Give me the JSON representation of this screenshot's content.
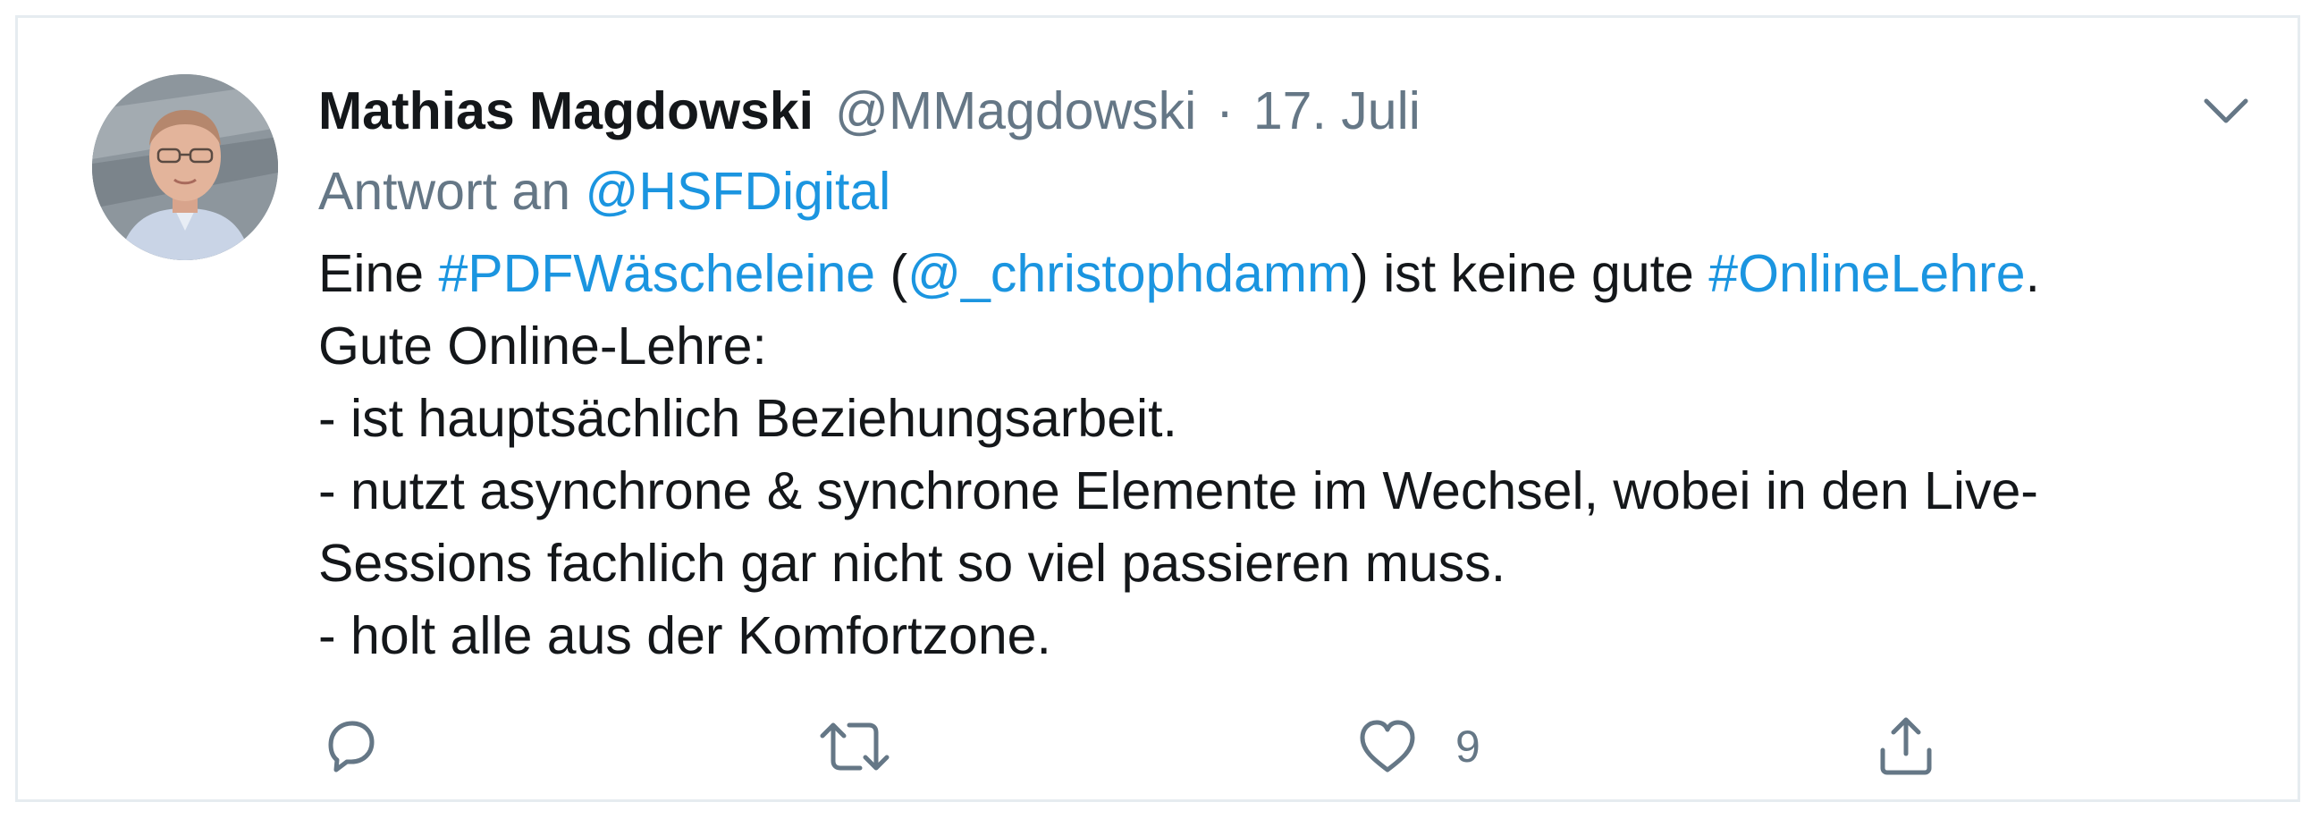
{
  "tweet": {
    "author": {
      "display_name": "Mathias Magdowski",
      "handle": "@MMagdowski"
    },
    "separator": "·",
    "timestamp": "17. Juli",
    "reply": {
      "prefix": "Antwort an ",
      "to_handle": "@HSFDigital"
    },
    "body": {
      "line1": {
        "t1": "Eine ",
        "hashtag1": "#PDFWäscheleine",
        "t2": " (",
        "mention": "@_christophdamm",
        "t3": ") ist keine gute ",
        "hashtag2": "#OnlineLehre",
        "t4": "."
      },
      "line2": "Gute Online-Lehre:",
      "line3": "- ist hauptsächlich Beziehungsarbeit.",
      "line4": "- nutzt asynchrone & synchrone Elemente im Wechsel, wobei in den Live-",
      "line5": "Sessions fachlich gar nicht so viel passieren muss.",
      "line6": "- holt alle aus der Komfortzone."
    },
    "actions": {
      "reply_icon": "reply-icon",
      "retweet_icon": "retweet-icon",
      "like_icon": "heart-icon",
      "like_count": "9",
      "share_icon": "share-icon",
      "menu_icon": "chevron-down-icon"
    }
  },
  "colors": {
    "text": "#14171a",
    "secondary": "#657786",
    "link": "#1b95e0",
    "border": "#e6ecf0"
  }
}
